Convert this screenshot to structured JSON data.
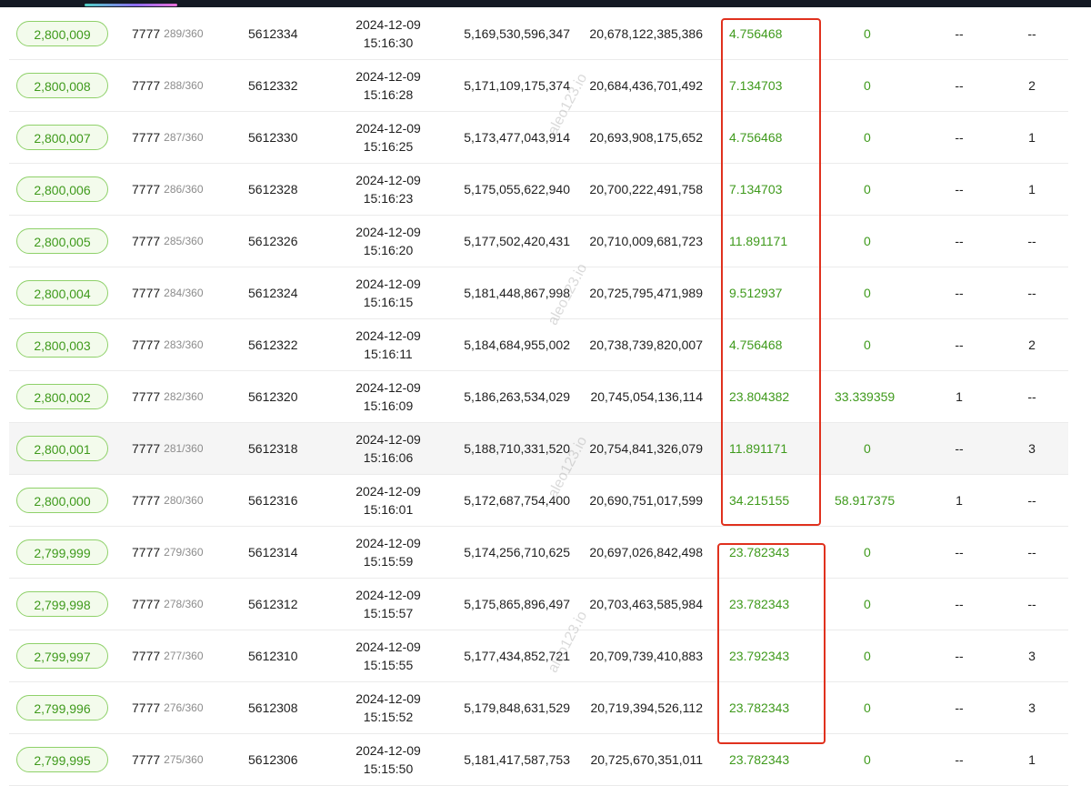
{
  "watermark": "aleo123.io",
  "rows": [
    {
      "height": "2,800,009",
      "epoch": "7777",
      "epoch_index": "289/360",
      "round": "5612334",
      "date": "2024-12-09",
      "time": "15:16:30",
      "difficulty": "5,169,530,596,347",
      "target": "20,678,122,385,386",
      "reward": "4.756468",
      "extra": "0",
      "col_a": "--",
      "col_b": "--"
    },
    {
      "height": "2,800,008",
      "epoch": "7777",
      "epoch_index": "288/360",
      "round": "5612332",
      "date": "2024-12-09",
      "time": "15:16:28",
      "difficulty": "5,171,109,175,374",
      "target": "20,684,436,701,492",
      "reward": "7.134703",
      "extra": "0",
      "col_a": "--",
      "col_b": "2"
    },
    {
      "height": "2,800,007",
      "epoch": "7777",
      "epoch_index": "287/360",
      "round": "5612330",
      "date": "2024-12-09",
      "time": "15:16:25",
      "difficulty": "5,173,477,043,914",
      "target": "20,693,908,175,652",
      "reward": "4.756468",
      "extra": "0",
      "col_a": "--",
      "col_b": "1"
    },
    {
      "height": "2,800,006",
      "epoch": "7777",
      "epoch_index": "286/360",
      "round": "5612328",
      "date": "2024-12-09",
      "time": "15:16:23",
      "difficulty": "5,175,055,622,940",
      "target": "20,700,222,491,758",
      "reward": "7.134703",
      "extra": "0",
      "col_a": "--",
      "col_b": "1"
    },
    {
      "height": "2,800,005",
      "epoch": "7777",
      "epoch_index": "285/360",
      "round": "5612326",
      "date": "2024-12-09",
      "time": "15:16:20",
      "difficulty": "5,177,502,420,431",
      "target": "20,710,009,681,723",
      "reward": "11.891171",
      "extra": "0",
      "col_a": "--",
      "col_b": "--"
    },
    {
      "height": "2,800,004",
      "epoch": "7777",
      "epoch_index": "284/360",
      "round": "5612324",
      "date": "2024-12-09",
      "time": "15:16:15",
      "difficulty": "5,181,448,867,998",
      "target": "20,725,795,471,989",
      "reward": "9.512937",
      "extra": "0",
      "col_a": "--",
      "col_b": "--"
    },
    {
      "height": "2,800,003",
      "epoch": "7777",
      "epoch_index": "283/360",
      "round": "5612322",
      "date": "2024-12-09",
      "time": "15:16:11",
      "difficulty": "5,184,684,955,002",
      "target": "20,738,739,820,007",
      "reward": "4.756468",
      "extra": "0",
      "col_a": "--",
      "col_b": "2"
    },
    {
      "height": "2,800,002",
      "epoch": "7777",
      "epoch_index": "282/360",
      "round": "5612320",
      "date": "2024-12-09",
      "time": "15:16:09",
      "difficulty": "5,186,263,534,029",
      "target": "20,745,054,136,114",
      "reward": "23.804382",
      "extra": "33.339359",
      "col_a": "1",
      "col_b": "--"
    },
    {
      "height": "2,800,001",
      "epoch": "7777",
      "epoch_index": "281/360",
      "round": "5612318",
      "date": "2024-12-09",
      "time": "15:16:06",
      "difficulty": "5,188,710,331,520",
      "target": "20,754,841,326,079",
      "reward": "11.891171",
      "extra": "0",
      "col_a": "--",
      "col_b": "3"
    },
    {
      "height": "2,800,000",
      "epoch": "7777",
      "epoch_index": "280/360",
      "round": "5612316",
      "date": "2024-12-09",
      "time": "15:16:01",
      "difficulty": "5,172,687,754,400",
      "target": "20,690,751,017,599",
      "reward": "34.215155",
      "extra": "58.917375",
      "col_a": "1",
      "col_b": "--"
    },
    {
      "height": "2,799,999",
      "epoch": "7777",
      "epoch_index": "279/360",
      "round": "5612314",
      "date": "2024-12-09",
      "time": "15:15:59",
      "difficulty": "5,174,256,710,625",
      "target": "20,697,026,842,498",
      "reward": "23.782343",
      "extra": "0",
      "col_a": "--",
      "col_b": "--"
    },
    {
      "height": "2,799,998",
      "epoch": "7777",
      "epoch_index": "278/360",
      "round": "5612312",
      "date": "2024-12-09",
      "time": "15:15:57",
      "difficulty": "5,175,865,896,497",
      "target": "20,703,463,585,984",
      "reward": "23.782343",
      "extra": "0",
      "col_a": "--",
      "col_b": "--"
    },
    {
      "height": "2,799,997",
      "epoch": "7777",
      "epoch_index": "277/360",
      "round": "5612310",
      "date": "2024-12-09",
      "time": "15:15:55",
      "difficulty": "5,177,434,852,721",
      "target": "20,709,739,410,883",
      "reward": "23.792343",
      "extra": "0",
      "col_a": "--",
      "col_b": "3"
    },
    {
      "height": "2,799,996",
      "epoch": "7777",
      "epoch_index": "276/360",
      "round": "5612308",
      "date": "2024-12-09",
      "time": "15:15:52",
      "difficulty": "5,179,848,631,529",
      "target": "20,719,394,526,112",
      "reward": "23.782343",
      "extra": "0",
      "col_a": "--",
      "col_b": "3"
    },
    {
      "height": "2,799,995",
      "epoch": "7777",
      "epoch_index": "275/360",
      "round": "5612306",
      "date": "2024-12-09",
      "time": "15:15:50",
      "difficulty": "5,181,417,587,753",
      "target": "20,725,670,351,011",
      "reward": "23.782343",
      "extra": "0",
      "col_a": "--",
      "col_b": "1"
    }
  ]
}
